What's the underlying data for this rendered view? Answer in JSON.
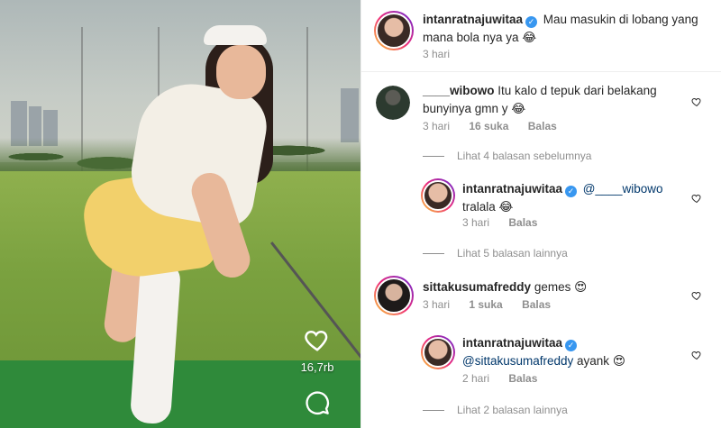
{
  "post": {
    "like_count": "16,7rb"
  },
  "caption": {
    "username": "intanratnajuwitaa",
    "text": "Mau masukin di lobang yang mana bola nya ya",
    "emoji": "😂",
    "time": "3 hari"
  },
  "comments": [
    {
      "username": "____wibowo",
      "text": "Itu kalo d tepuk  dari belakang bunyinya gmn y",
      "emoji": "😂",
      "time": "3 hari",
      "likes": "16 suka",
      "reply_label": "Balas",
      "view_replies": "Lihat 4 balasan sebelumnya"
    },
    {
      "username": "intanratnajuwitaa",
      "mention": "@____wibowo",
      "text": "tralala",
      "emoji": "😂",
      "time": "3 hari",
      "reply_label": "Balas",
      "view_replies": "Lihat 5 balasan lainnya"
    },
    {
      "username": "sittakusumafreddy",
      "text": "gemes",
      "emoji": "😍",
      "time": "3 hari",
      "likes": "1 suka",
      "reply_label": "Balas"
    },
    {
      "username": "intanratnajuwitaa",
      "mention": "@sittakusumafreddy",
      "text": "ayank",
      "emoji": "😍",
      "time": "2 hari",
      "reply_label": "Balas",
      "view_replies": "Lihat 2 balasan lainnya"
    }
  ],
  "icons": {
    "verified": "verified-badge-icon",
    "like": "heart-icon",
    "comment": "comment-icon"
  },
  "colors": {
    "verified": "#3897f0",
    "meta": "#8e8e8e",
    "mention": "#00376b"
  }
}
